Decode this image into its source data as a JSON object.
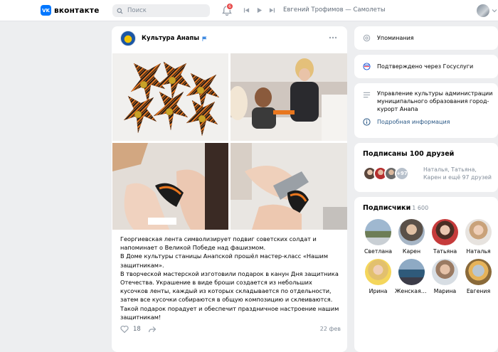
{
  "header": {
    "logo_mark": "VK",
    "logo_text": "вконтакте",
    "search_placeholder": "Поиск",
    "notifications_count": "6",
    "now_playing": "Евгений Трофимов — Самолеты"
  },
  "post": {
    "group_name": "Культура Анапы",
    "text": [
      "Георгиевская лента символизирует подвиг советских солдат и напоминает о Великой Победе над фашизмом.",
      "В Доме культуры станицы Анапской прошёл мастер-класс «Нашим защитникам».",
      "В творческой мастерской изготовили подарок в канун Дня защитника Отечества. Украшение в виде броши создается из небольших кусочков ленты, каждый из которых складывается по отдельности, затем все кусочки собираются в общую композицию и склеиваются.",
      "Такой подарок порадует и обеспечит праздничное настроение нашим защитникам!"
    ],
    "likes": "18",
    "date": "22 фев"
  },
  "sidebar": {
    "mentions": "Упоминания",
    "gosuslugi": "Подтверждено через Госуслуги",
    "org": "Управление культуры администрации муниципального образования город-курорт Анапа",
    "more_info": "Подробная информация",
    "friends_title": "Подписаны 100 друзей",
    "friends_more": "+97",
    "friends_names": "Наталья, Татьяна, Карен и ещё 97 друзей",
    "subs_title": "Подписчики",
    "subs_count": "1 600",
    "subscribers": [
      {
        "name": "Светлана"
      },
      {
        "name": "Карен"
      },
      {
        "name": "Татьяна"
      },
      {
        "name": "Наталья"
      },
      {
        "name": "Ирина"
      },
      {
        "name": "Женская К..."
      },
      {
        "name": "Марина"
      },
      {
        "name": "Евгения"
      }
    ]
  },
  "colors": {
    "accent": "#0077ff",
    "link": "#2a5885",
    "ribbon_orange": "#e8761e",
    "ribbon_black": "#1b1b1b"
  }
}
